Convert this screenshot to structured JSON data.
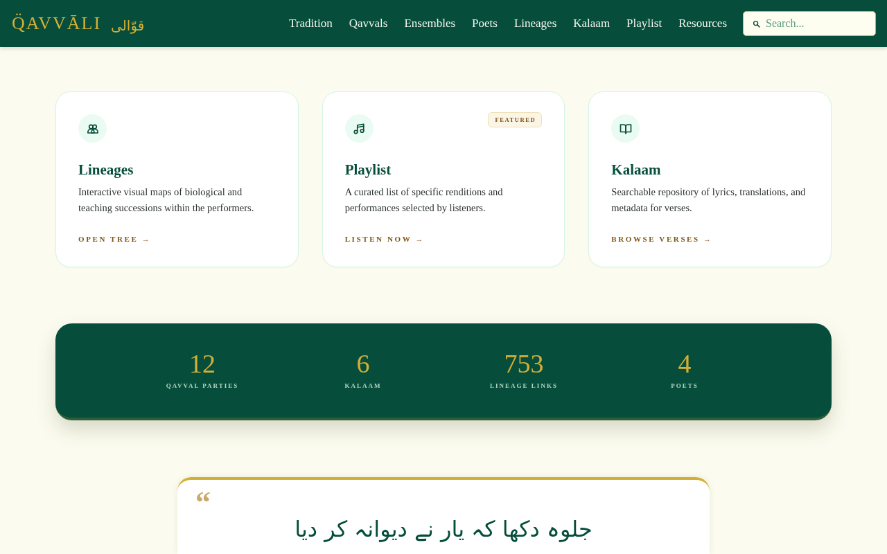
{
  "header": {
    "logo": {
      "latin": "Q̈AVVĀLI",
      "urdu": "قوّالی"
    },
    "nav": [
      "Tradition",
      "Qavvals",
      "Ensembles",
      "Poets",
      "Lineages",
      "Kalaam",
      "Playlist",
      "Resources"
    ],
    "search": {
      "placeholder": "Search..."
    }
  },
  "cards": [
    {
      "title": "Lineages",
      "description": "Interactive visual maps of biological and teaching successions within the performers.",
      "link": "OPEN TREE →"
    },
    {
      "title": "Playlist",
      "badge": "FEATURED",
      "description": "A curated list of specific renditions and performances selected by listeners.",
      "link": "LISTEN NOW →"
    },
    {
      "title": "Kalaam",
      "description": "Searchable repository of lyrics, translations, and metadata for verses.",
      "link": "BROWSE VERSES →"
    }
  ],
  "stats": [
    {
      "value": "12",
      "label": "QAVVAL PARTIES"
    },
    {
      "value": "6",
      "label": "KALAAM"
    },
    {
      "value": "753",
      "label": "LINEAGE LINKS"
    },
    {
      "value": "4",
      "label": "POETS"
    }
  ],
  "quote": {
    "mark": "“",
    "text": "جلوہ دکھا کہ یار نے دیوانہ کر دیا"
  }
}
